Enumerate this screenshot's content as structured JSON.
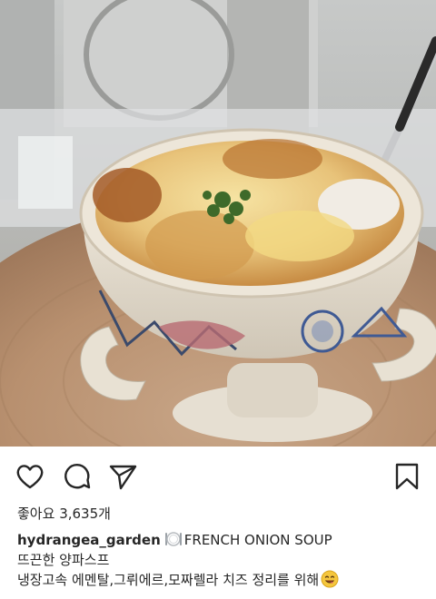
{
  "post": {
    "image_subject": "french-onion-soup-photo",
    "actions": {
      "like_icon": "heart-icon",
      "comment_icon": "comment-bubble-icon",
      "share_icon": "paper-plane-icon",
      "save_icon": "bookmark-icon"
    },
    "likes": {
      "label": "좋아요",
      "count": "3,635",
      "suffix": "개"
    },
    "caption": {
      "username": "hydrangea_garden",
      "emoji_1": "plate-with-cutlery-emoji",
      "title": "FRENCH ONION SOUP",
      "line2": "뜨끈한 양파스프",
      "line3": "냉장고속 에멘탈,그뤼에르,모짜렐라 치즈 정리를 위해",
      "emoji_2": "smiling-face-emoji"
    }
  }
}
